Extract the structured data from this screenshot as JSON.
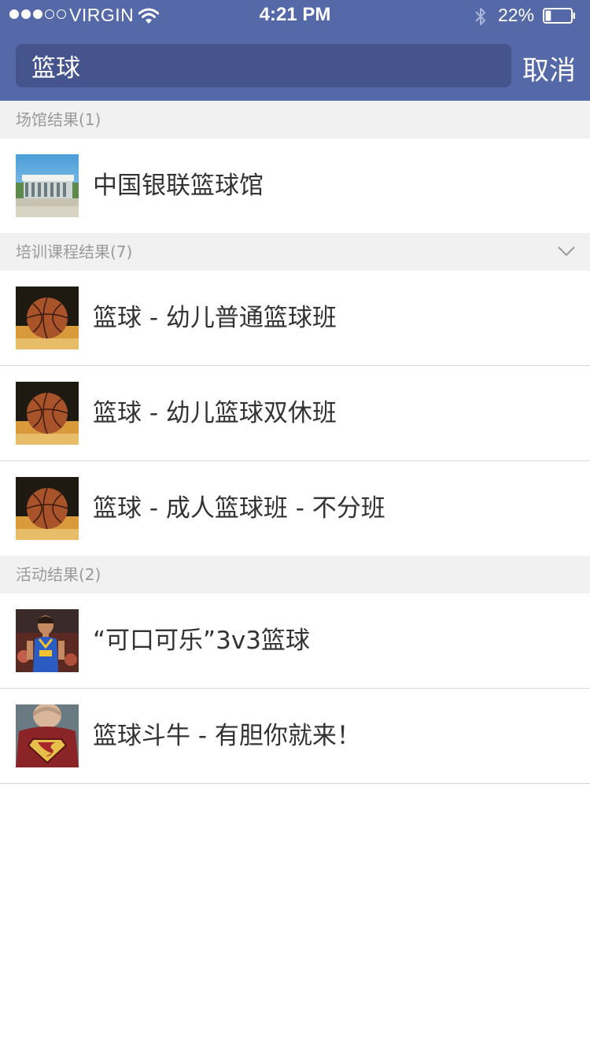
{
  "status_bar": {
    "carrier": "VIRGIN",
    "time": "4:21 PM",
    "battery": "22%",
    "battery_level": 0.22
  },
  "search": {
    "query": "篮球",
    "cancel_label": "取消"
  },
  "sections": [
    {
      "header": "场馆结果(1)",
      "items": [
        {
          "title": "中国银联篮球馆",
          "thumb": "venue-building"
        }
      ]
    },
    {
      "header": "培训课程结果(7)",
      "collapsed_icon": "chevron-down-icon",
      "items": [
        {
          "title": "篮球 - 幼儿普通篮球班",
          "thumb": "basketball"
        },
        {
          "title": "篮球 - 幼儿篮球双休班",
          "thumb": "basketball"
        },
        {
          "title": "篮球 - 成人篮球班 - 不分班",
          "thumb": "basketball"
        }
      ]
    },
    {
      "header": "活动结果(2)",
      "items": [
        {
          "title": "“可口可乐”3v3篮球",
          "thumb": "player-photo"
        },
        {
          "title": "篮球斗牛 - 有胆你就来！",
          "thumb": "superman-shirt"
        }
      ]
    }
  ],
  "colors": {
    "header_bg": "#5568a8",
    "search_bg": "#45548c",
    "section_bg": "#f1f1f2",
    "section_text": "#9a9a9a",
    "row_text": "#333333",
    "divider": "#d8d8d8"
  }
}
